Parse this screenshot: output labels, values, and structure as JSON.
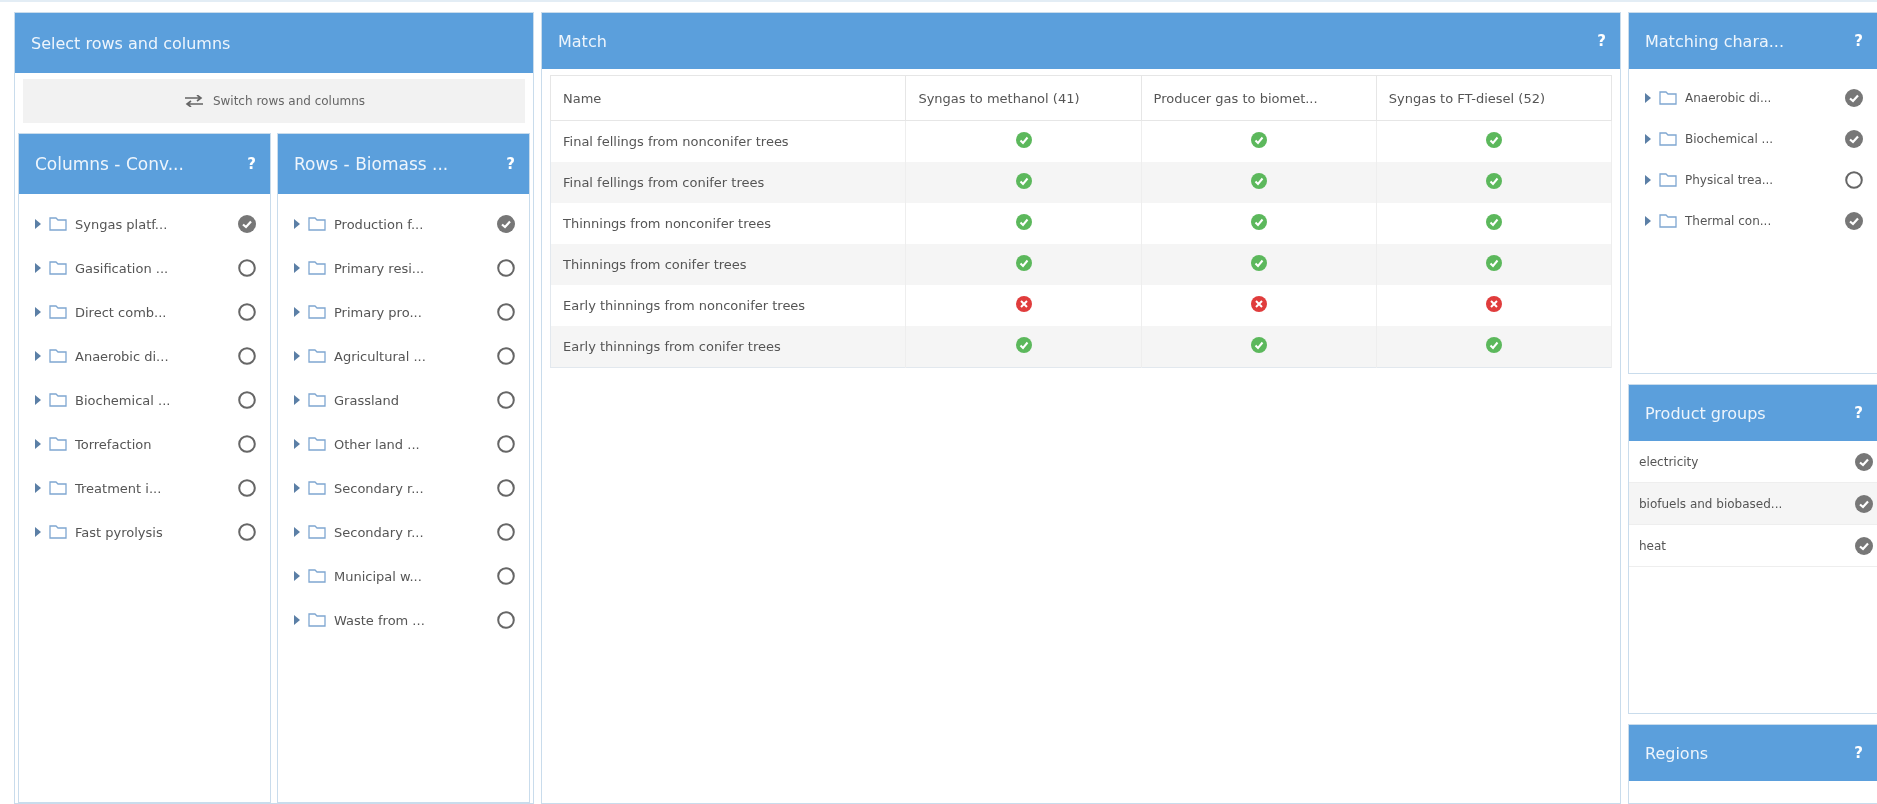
{
  "select_panel": {
    "title": "Select rows and columns",
    "switch_button": "Switch rows and columns",
    "columns_panel": {
      "title": "Columns - Conv...",
      "help": "?",
      "items": [
        {
          "label": "Syngas platf...",
          "checked": true
        },
        {
          "label": "Gasification ...",
          "checked": false
        },
        {
          "label": "Direct comb...",
          "checked": false
        },
        {
          "label": "Anaerobic di...",
          "checked": false
        },
        {
          "label": "Biochemical ...",
          "checked": false
        },
        {
          "label": "Torrefaction",
          "checked": false
        },
        {
          "label": "Treatment i...",
          "checked": false
        },
        {
          "label": "Fast pyrolysis",
          "checked": false
        }
      ]
    },
    "rows_panel": {
      "title": "Rows - Biomass ...",
      "help": "?",
      "items": [
        {
          "label": "Production f...",
          "checked": true
        },
        {
          "label": "Primary resi...",
          "checked": false
        },
        {
          "label": "Primary pro...",
          "checked": false
        },
        {
          "label": "Agricultural ...",
          "checked": false
        },
        {
          "label": "Grassland",
          "checked": false
        },
        {
          "label": "Other land ...",
          "checked": false
        },
        {
          "label": "Secondary r...",
          "checked": false
        },
        {
          "label": "Secondary r...",
          "checked": false
        },
        {
          "label": "Municipal w...",
          "checked": false
        },
        {
          "label": "Waste from ...",
          "checked": false
        }
      ]
    }
  },
  "match_panel": {
    "title": "Match",
    "help": "?",
    "table": {
      "columns": [
        "Name",
        "Syngas to methanol (41)",
        "Producer gas to biomet...",
        "Syngas to FT-diesel (52)"
      ],
      "rows": [
        {
          "name": "Final fellings from nonconifer trees",
          "matches": [
            true,
            true,
            true
          ]
        },
        {
          "name": "Final fellings from conifer trees",
          "matches": [
            true,
            true,
            true
          ]
        },
        {
          "name": "Thinnings from nonconifer trees",
          "matches": [
            true,
            true,
            true
          ]
        },
        {
          "name": "Thinnings from conifer trees",
          "matches": [
            true,
            true,
            true
          ]
        },
        {
          "name": "Early thinnings from nonconifer trees",
          "matches": [
            false,
            false,
            false
          ]
        },
        {
          "name": "Early thinnings from conifer trees",
          "matches": [
            true,
            true,
            true
          ]
        }
      ]
    }
  },
  "matching_panel": {
    "title": "Matching chara...",
    "help": "?",
    "items": [
      {
        "label": "Anaerobic di...",
        "checked": true
      },
      {
        "label": "Biochemical ...",
        "checked": true
      },
      {
        "label": "Physical trea...",
        "checked": false
      },
      {
        "label": "Thermal con...",
        "checked": true
      }
    ]
  },
  "product_groups": {
    "title": "Product groups",
    "help": "?",
    "items": [
      {
        "label": "electricity",
        "checked": true
      },
      {
        "label": "biofuels and biobased...",
        "checked": true
      },
      {
        "label": "heat",
        "checked": true
      }
    ]
  },
  "regions": {
    "title": "Regions",
    "help": "?"
  }
}
